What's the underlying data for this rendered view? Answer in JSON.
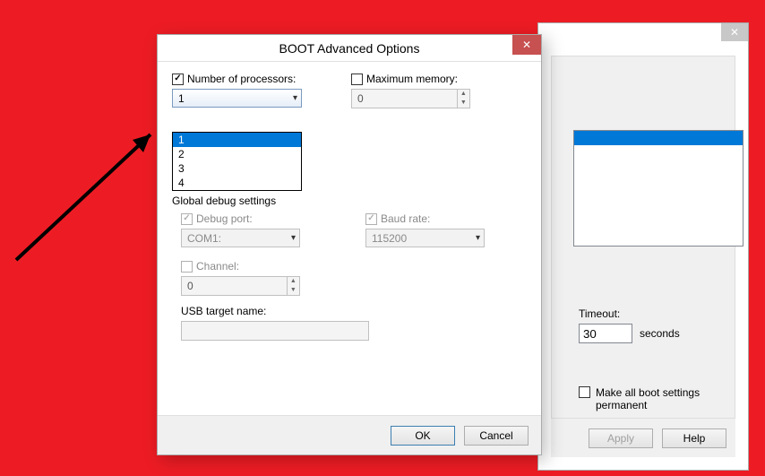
{
  "front": {
    "title": "BOOT Advanced Options",
    "num_processors_label": "Number of processors:",
    "num_processors_checked": true,
    "num_processors_value": "1",
    "num_processors_options": [
      "1",
      "2",
      "3",
      "4"
    ],
    "max_memory_label": "Maximum memory:",
    "max_memory_checked": false,
    "max_memory_value": "0",
    "global_debug_label": "Global debug settings",
    "debug_port_label": "Debug port:",
    "debug_port_checked": true,
    "debug_port_value": "COM1:",
    "baud_rate_label": "Baud rate:",
    "baud_rate_checked": true,
    "baud_rate_value": "115200",
    "channel_label": "Channel:",
    "channel_checked": false,
    "channel_value": "0",
    "usb_target_label": "USB target name:",
    "usb_target_value": "",
    "ok": "OK",
    "cancel": "Cancel"
  },
  "back": {
    "timeout_label": "Timeout:",
    "timeout_value": "30",
    "timeout_unit": "seconds",
    "permanent_label": "Make all boot settings permanent",
    "apply": "Apply",
    "help": "Help"
  }
}
